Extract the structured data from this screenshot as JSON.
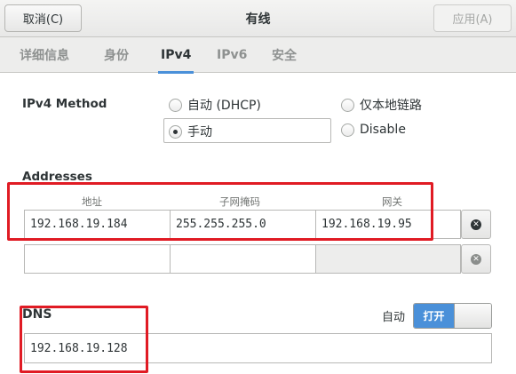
{
  "header": {
    "cancel_label": "取消(C)",
    "title": "有线",
    "apply_label": "应用(A)"
  },
  "tabs": [
    {
      "label": "详细信息"
    },
    {
      "label": "身份"
    },
    {
      "label": "IPv4",
      "active": true
    },
    {
      "label": "IPv6"
    },
    {
      "label": "安全"
    }
  ],
  "ipv4": {
    "method_label": "IPv4 Method",
    "methods": [
      {
        "label": "自动 (DHCP)",
        "checked": false
      },
      {
        "label": "仅本地链路",
        "checked": false
      },
      {
        "label": "手动",
        "checked": true
      },
      {
        "label": "Disable",
        "checked": false
      }
    ],
    "addresses_label": "Addresses",
    "columns": [
      "地址",
      "子网掩码",
      "网关"
    ],
    "rows": [
      {
        "address": "192.168.19.184",
        "netmask": "255.255.255.0",
        "gateway": "192.168.19.95"
      },
      {
        "address": "",
        "netmask": "",
        "gateway": ""
      }
    ],
    "dns_label": "DNS",
    "dns_auto_label": "自动",
    "dns_toggle_label": "打开",
    "dns_value": "192.168.19.128"
  },
  "colors": {
    "accent": "#4a90d9",
    "highlight_red": "#e01b24"
  }
}
